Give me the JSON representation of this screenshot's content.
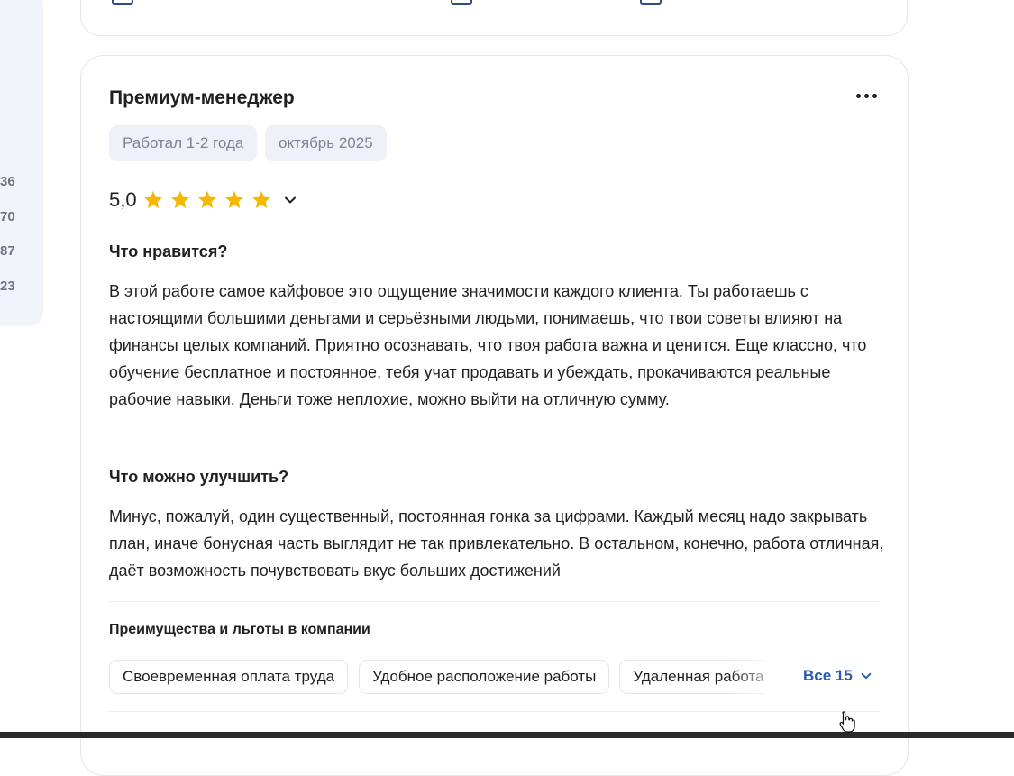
{
  "sidebar": {
    "numbers": [
      "36",
      "70",
      "87",
      "23"
    ]
  },
  "review": {
    "title": "Премиум-менеджер",
    "tags": [
      "Работал 1-2 года",
      "октябрь 2025"
    ],
    "rating": "5,0",
    "stars": 5,
    "likes_title": "Что нравится?",
    "likes_text": "В этой работе самое кайфовое это ощущение значимости каждого клиента. Ты работаешь с настоящими большими деньгами и серьёзными людьми, понимаешь, что твои советы влияют на финансы целых компаний. Приятно осознавать, что твоя работа важна и ценится. Еще классно, что обучение бесплатное и постоянное, тебя учат продавать и убеждать, прокачиваются реальные рабочие навыки. Деньги тоже неплохие, можно выйти на отличную сумму.",
    "improve_title": "Что можно улучшить?",
    "improve_text": "Минус, пожалуй, один существенный, постоянная гонка за цифрами. Каждый месяц надо закрывать план, иначе бонусная часть выглядит не так привлекательно. В остальном, конечно, работа отличная, даёт возможность почувствовать вкус больших достижений",
    "benefits_title": "Преимущества и льготы в компании",
    "benefits": [
      "Своевременная оплата труда",
      "Удобное расположение работы",
      "Удаленная работа"
    ],
    "all_label": "Все 15"
  },
  "colors": {
    "star": "#f5b700",
    "link": "#2d5ab0",
    "tag_bg": "#eef1f7"
  },
  "icons": [
    "more-icon",
    "star-icon",
    "chevron-down-icon",
    "hand-cursor-icon"
  ]
}
